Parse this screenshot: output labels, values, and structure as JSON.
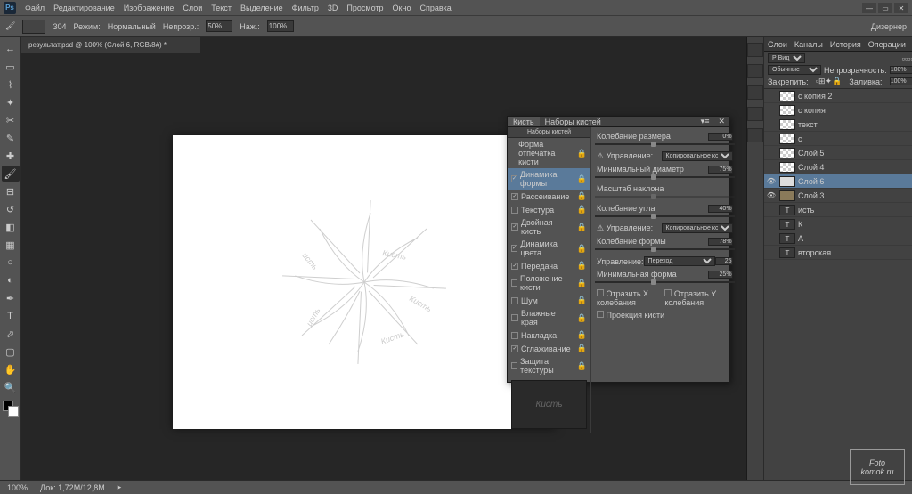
{
  "menu": {
    "items": [
      "Файл",
      "Редактирование",
      "Изображение",
      "Слои",
      "Текст",
      "Выделение",
      "Фильтр",
      "3D",
      "Просмотр",
      "Окно",
      "Справка"
    ]
  },
  "optbar": {
    "size_label": "304",
    "mode": "Режим:",
    "mode_val": "Нормальный",
    "opacity": "Непрозр.:",
    "opacity_val": "50%",
    "flow": "Наж.:",
    "flow_val": "100%",
    "right": "Дизернер"
  },
  "doc": {
    "tab": "результат.psd @ 100% (Слой 6, RGB/8#) *"
  },
  "brushpanel": {
    "tab1": "Кисть",
    "tab2": "Наборы кистей",
    "presets_btn": "Наборы кистей",
    "items": [
      {
        "label": "Форма отпечатка кисти",
        "checked": false,
        "nocb": true
      },
      {
        "label": "Динамика формы",
        "checked": true,
        "sel": true
      },
      {
        "label": "Рассеивание",
        "checked": true
      },
      {
        "label": "Текстура",
        "checked": false
      },
      {
        "label": "Двойная кисть",
        "checked": true
      },
      {
        "label": "Динамика цвета",
        "checked": true
      },
      {
        "label": "Передача",
        "checked": true
      },
      {
        "label": "Положение кисти",
        "checked": false
      },
      {
        "label": "Шум",
        "checked": false
      },
      {
        "label": "Влажные края",
        "checked": false
      },
      {
        "label": "Накладка",
        "checked": false
      },
      {
        "label": "Сглаживание",
        "checked": true
      },
      {
        "label": "Защита текстуры",
        "checked": false
      }
    ],
    "right": {
      "size_jitter": "Колебание размера",
      "size_jitter_val": "0%",
      "control": "Управление:",
      "control_val": "Копировальное колесико",
      "min_diam": "Минимальный диаметр",
      "min_diam_val": "75%",
      "tilt": "Масштаб наклона",
      "angle_jitter": "Колебание угла",
      "angle_jitter_val": "40%",
      "control2": "Управление:",
      "control2_val": "Копировальное колесико",
      "round_jitter": "Колебание формы",
      "round_jitter_val": "78%",
      "control3": "Управление:",
      "control3_val": "Переход",
      "control3_n": "25",
      "min_round": "Минимальная форма",
      "min_round_val": "25%",
      "flipx": "Отразить X колебания",
      "flipy": "Отразить Y колебания",
      "proj": "Проекция кисти"
    }
  },
  "layerspanel": {
    "tabs": [
      "Слои",
      "Каналы",
      "История",
      "Операции"
    ],
    "kind": "Р Вид",
    "blend": "Обычные",
    "opacity_lbl": "Непрозрачность:",
    "opacity": "100%",
    "lock_lbl": "Закрепить:",
    "fill_lbl": "Заливка:",
    "fill": "100%",
    "layers": [
      {
        "vis": false,
        "name": "с копия 2",
        "thumb": "t"
      },
      {
        "vis": false,
        "name": "с копия",
        "thumb": "t"
      },
      {
        "vis": false,
        "name": "текст",
        "thumb": "t"
      },
      {
        "vis": false,
        "name": "с",
        "thumb": "t"
      },
      {
        "vis": false,
        "name": "Слой 5",
        "thumb": "t"
      },
      {
        "vis": false,
        "name": "Слой 4",
        "thumb": "t"
      },
      {
        "vis": true,
        "name": "Слой 6",
        "thumb": "w",
        "sel": true
      },
      {
        "vis": true,
        "name": "Слой 3",
        "thumb": "img"
      },
      {
        "vis": false,
        "name": "исть",
        "thumb": "T"
      },
      {
        "vis": false,
        "name": "К",
        "thumb": "T"
      },
      {
        "vis": false,
        "name": "А",
        "thumb": "T"
      },
      {
        "vis": false,
        "name": "вторская",
        "thumb": "T"
      }
    ]
  },
  "status": {
    "zoom": "100%",
    "doc": "Док: 1,72M/12,8M"
  },
  "wm": {
    "l1": "Foto",
    "l2": "komok.ru"
  }
}
